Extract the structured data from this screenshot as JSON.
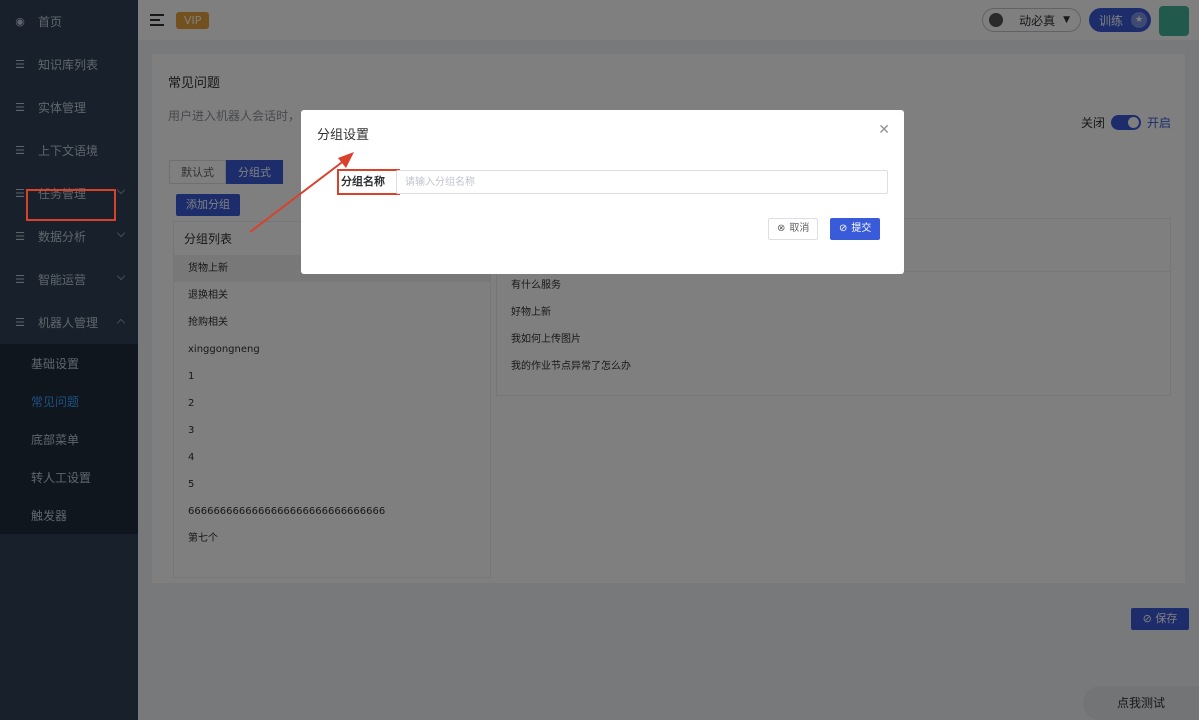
{
  "sidebar": {
    "items": [
      {
        "label": "首页",
        "icon": "dashboard-icon"
      },
      {
        "label": "知识库列表",
        "icon": "list-icon"
      },
      {
        "label": "实体管理",
        "icon": "list-icon"
      },
      {
        "label": "上下文语境",
        "icon": "list-icon"
      },
      {
        "label": "任务管理",
        "icon": "list-icon",
        "expandable": true
      },
      {
        "label": "数据分析",
        "icon": "list-icon",
        "expandable": true
      },
      {
        "label": "智能运营",
        "icon": "list-icon",
        "expandable": true
      },
      {
        "label": "机器人管理",
        "icon": "list-icon",
        "expanded": true
      }
    ],
    "subitems": [
      {
        "label": "基础设置"
      },
      {
        "label": "常见问题",
        "active": true
      },
      {
        "label": "底部菜单"
      },
      {
        "label": "转人工设置"
      },
      {
        "label": "触发器"
      }
    ]
  },
  "topbar": {
    "vip": "VIP",
    "user_name": "动必真",
    "train_label": "训练"
  },
  "faq": {
    "title": "常见问题",
    "description": "用户进入机器人会话时，会",
    "switch_off": "关闭",
    "switch_on": "开启",
    "switch_state": true
  },
  "tabs": [
    "默认式",
    "分组式"
  ],
  "add_group_button": "添加分组",
  "group_list": {
    "header": "分组列表",
    "items": [
      "货物上新",
      "退换相关",
      "抢购相关",
      "xinggongneng",
      "1",
      "2",
      "3",
      "4",
      "5",
      "6666666666666666666666666666666",
      "第七个"
    ]
  },
  "questions": [
    "有什么服务",
    "好物上新",
    "我如何上传图片",
    "我的作业节点异常了怎么办"
  ],
  "save_button": "保存",
  "test_button": "点我测试",
  "modal": {
    "title": "分组设置",
    "field_label": "分组名称",
    "field_placeholder": "请输入分组名称",
    "field_value": "",
    "cancel": "取消",
    "submit": "提交"
  },
  "colors": {
    "sidebar_bg": "#304156",
    "primary": "#3a5bd9",
    "annotation_red": "#d9412b",
    "vip": "#e6a23c"
  }
}
